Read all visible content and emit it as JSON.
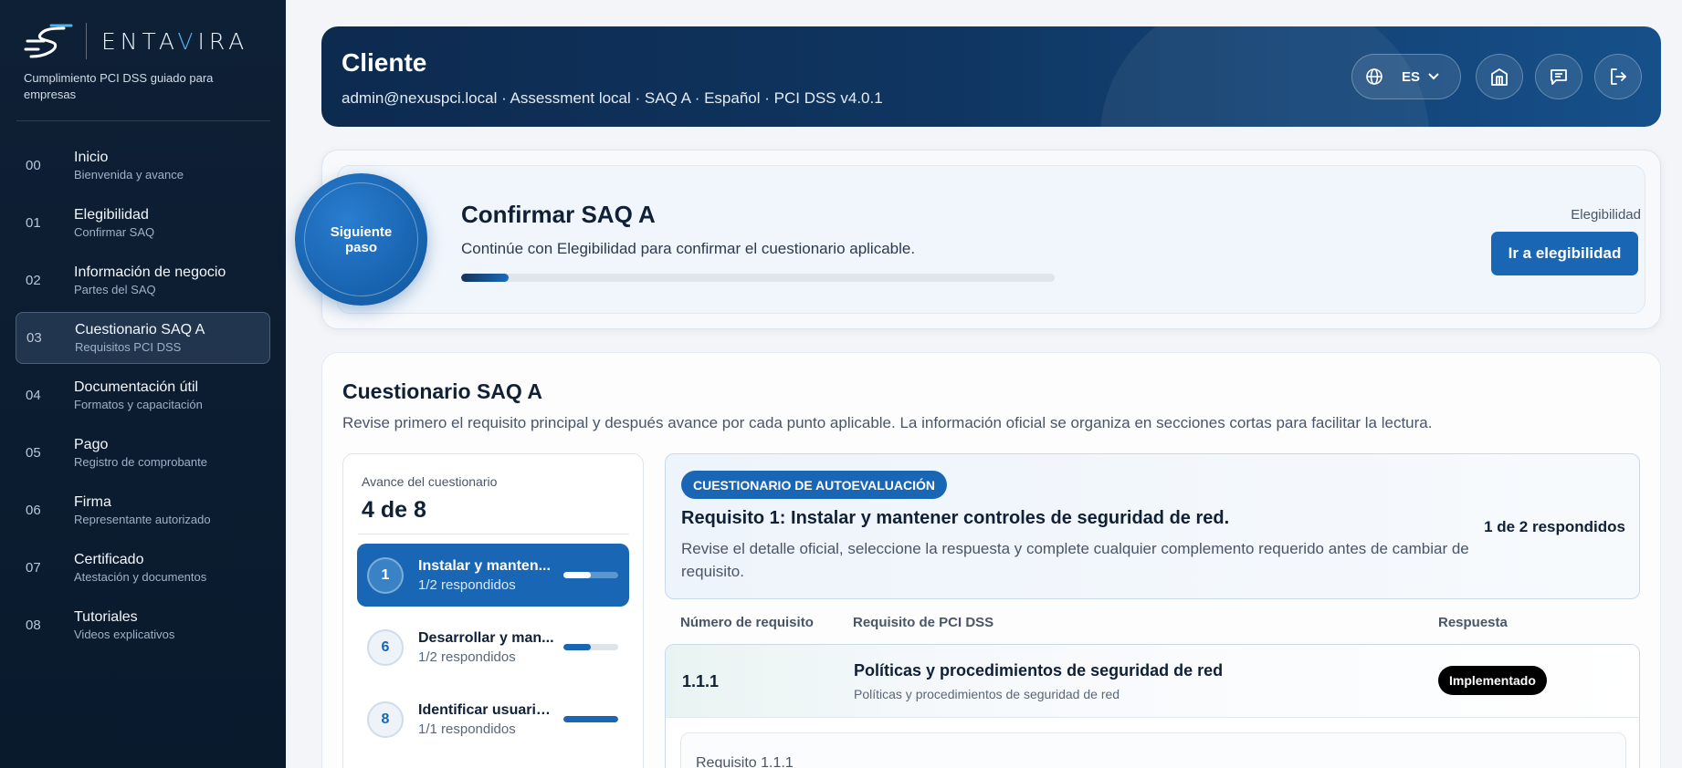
{
  "brand": {
    "name_pre": "ENTA",
    "name_accent": "V",
    "name_post": "IRA",
    "tagline": "Cumplimiento PCI DSS guiado para empresas"
  },
  "sidebar": {
    "items": [
      {
        "num": "00",
        "title": "Inicio",
        "sub": "Bienvenida y avance"
      },
      {
        "num": "01",
        "title": "Elegibilidad",
        "sub": "Confirmar SAQ"
      },
      {
        "num": "02",
        "title": "Información de negocio",
        "sub": "Partes del SAQ"
      },
      {
        "num": "03",
        "title": "Cuestionario SAQ A",
        "sub": "Requisitos PCI DSS",
        "active": true
      },
      {
        "num": "04",
        "title": "Documentación útil",
        "sub": "Formatos y capacitación"
      },
      {
        "num": "05",
        "title": "Pago",
        "sub": "Registro de comprobante"
      },
      {
        "num": "06",
        "title": "Firma",
        "sub": "Representante autorizado"
      },
      {
        "num": "07",
        "title": "Certificado",
        "sub": "Atestación y documentos"
      },
      {
        "num": "08",
        "title": "Tutoriales",
        "sub": "Videos explicativos"
      }
    ]
  },
  "header": {
    "title": "Cliente",
    "subtitle": "admin@nexuspci.local · Assessment local · SAQ A · Español · PCI DSS v4.0.1",
    "language": "ES",
    "icons": [
      "globe-icon",
      "chevron-down-icon",
      "building-icon",
      "chat-icon",
      "logout-icon"
    ]
  },
  "next_step": {
    "badge": "Siguiente paso",
    "title": "Confirmar SAQ A",
    "description": "Continúe con Elegibilidad para confirmar el cuestionario aplicable.",
    "progress_fraction": 0.08,
    "section_label": "Elegibilidad",
    "button_label": "Ir a elegibilidad"
  },
  "questionnaire": {
    "title": "Cuestionario SAQ A",
    "description": "Revise primero el requisito principal y después avance por cada punto aplicable. La información oficial se organiza en secciones cortas para facilitar la lectura.",
    "progress_label": "Avance del cuestionario",
    "progress_count": "4 de 8",
    "requirements": [
      {
        "num": "1",
        "name": "Instalar y manten...",
        "answered": "1/2 respondidos",
        "fraction": 0.5,
        "active": true
      },
      {
        "num": "6",
        "name": "Desarrollar y man...",
        "answered": "1/2 respondidos",
        "fraction": 0.5
      },
      {
        "num": "8",
        "name": "Identificar usuario...",
        "answered": "1/1 respondidos",
        "fraction": 1.0
      }
    ],
    "current": {
      "tag": "CUESTIONARIO DE AUTOEVALUACIÓN",
      "title": "Requisito 1: Instalar y mantener controles de seguridad de red.",
      "description": "Revise el detalle oficial, seleccione la respuesta y complete cualquier complemento requerido antes de cambiar de requisito.",
      "answered": "1 de 2 respondidos"
    },
    "table": {
      "headers": [
        "Número de requisito",
        "Requisito de PCI DSS",
        "Respuesta"
      ],
      "rows": [
        {
          "number": "1.1.1",
          "title": "Políticas y procedimientos de seguridad de red",
          "subtitle": "Políticas y procedimientos de seguridad de red",
          "answer": "Implementado",
          "detail_label": "Requisito 1.1.1"
        }
      ]
    }
  }
}
